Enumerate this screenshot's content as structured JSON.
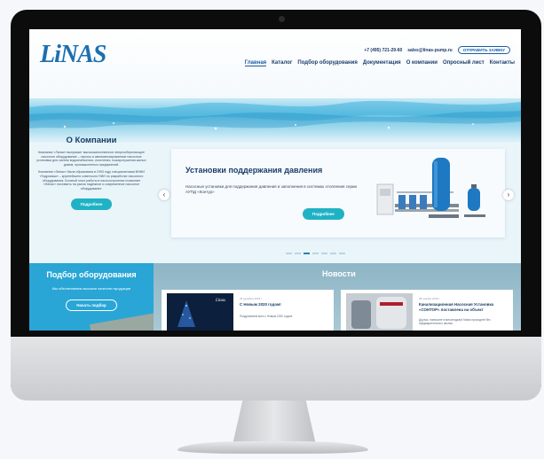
{
  "site": {
    "logo": "LiNAS",
    "phone": "+7 (495) 721-29-60",
    "email": "sales@linas-pump.ru",
    "request_button": "ОТПРАВИТЬ ЗАЯВКУ"
  },
  "nav": {
    "items": [
      {
        "label": "Главная",
        "active": true
      },
      {
        "label": "Каталог"
      },
      {
        "label": "Подбор оборудования"
      },
      {
        "label": "Документация"
      },
      {
        "label": "О компании"
      },
      {
        "label": "Опросный лист"
      },
      {
        "label": "Контакты"
      }
    ]
  },
  "about": {
    "title": "О Компании",
    "text1": "Компания «Линас» выпускает высококачественное энергосберегающее насосное оборудование – насосы и автоматизированные насосные установки для систем водоснабжения, отопления, пожаротушения жилых домов, промышленных предприятий.",
    "text2": "Компания «Линас» была образована в 1993 году специалистами ВНИИ «Гидромаш» – крупнейшего советского НИИ по разработке насосного оборудования. Богатый опыт работы в насосостроении позволяет «Линас» поставить на рынок надёжное и современное насосное оборудование.",
    "button": "Подробнее"
  },
  "slider": {
    "title": "Установки поддержания давления",
    "description": "Насосные установки для поддержания давления и заполнения в системах отопления серии АУПД «Контур»",
    "button": "Подробнее",
    "prev": "‹",
    "next": "›",
    "active_slide": 3,
    "slide_count": 7
  },
  "selection": {
    "title": "Подбор оборудования",
    "subtitle": "Мы обеспечиваем высокое качество продукции",
    "button": "Начать подбор"
  },
  "news": {
    "title": "Новости",
    "items": [
      {
        "date": "25 декабря 2019 г.",
        "title": "С Новым 2020 годом!",
        "text": "Поздравляем всех с Новым 2020 годом!",
        "image_logo": "Linas"
      },
      {
        "date": "28 ноября 2019 г.",
        "title": "Канализационная Насосная Установка «СОНТОР» поставлена на объект",
        "text": "Друзья, напишите в мессенджер! Мимо проходите без предварительного звонка."
      }
    ]
  },
  "colors": {
    "brand_blue": "#1c6fb0",
    "teal": "#1fb2c5",
    "panel_blue": "#29a6d6"
  }
}
